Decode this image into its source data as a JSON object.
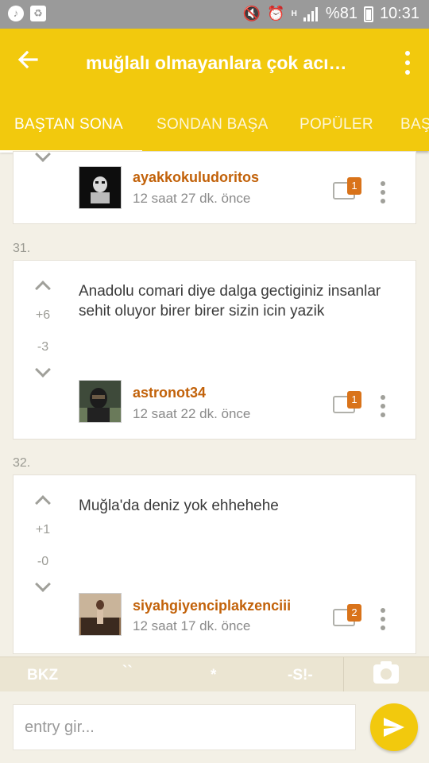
{
  "status_bar": {
    "battery": "%81",
    "time": "10:31",
    "network": "H"
  },
  "app_bar": {
    "title": "muğlalı olmayanlara çok acı…",
    "tabs": [
      "BAŞTAN SONA",
      "SONDAN BAŞA",
      "POPÜLER",
      "BAŞ"
    ]
  },
  "entries": [
    {
      "author": "ayakkokuludoritos",
      "time": "12 saat 27 dk. önce",
      "comments": "1"
    },
    {
      "number": "31.",
      "text": "Anadolu comari diye dalga gectiginiz insanlar sehit oluyor birer birer sizin icin yazik",
      "up": "+6",
      "down": "-3",
      "author": "astronot34",
      "time": "12 saat 22 dk. önce",
      "comments": "1"
    },
    {
      "number": "32.",
      "text": "Muğla'da deniz yok ehhehehe",
      "up": "+1",
      "down": "-0",
      "author": "siyahgiyenciplakzenciii",
      "time": "12 saat 17 dk. önce",
      "comments": "2"
    }
  ],
  "toolbar": {
    "bkz": "BKZ",
    "backtick": "``",
    "star": "*",
    "spoiler": "-S!-"
  },
  "composer": {
    "placeholder": "entry gir..."
  }
}
